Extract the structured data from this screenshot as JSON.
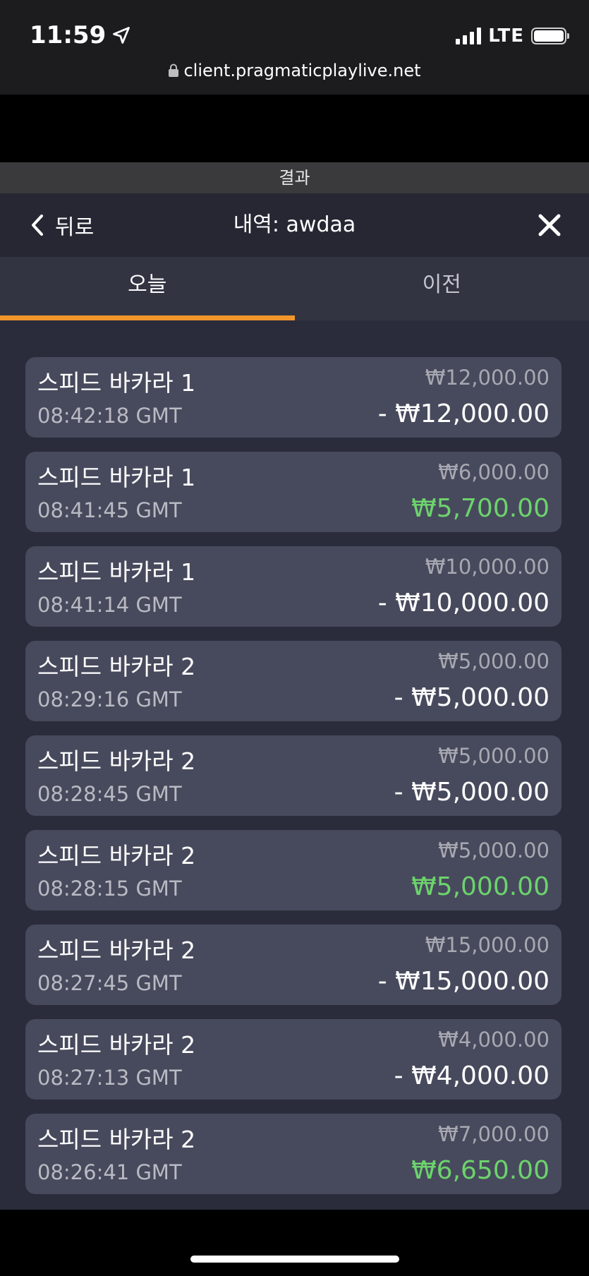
{
  "status_bar": {
    "time": "11:59",
    "network": "LTE",
    "url": "client.pragmaticplaylive.net"
  },
  "results_strip": {
    "label": "결과"
  },
  "header": {
    "back_label": "뒤로",
    "title": "내역: awdaa"
  },
  "tabs": [
    {
      "label": "오늘",
      "active": true
    },
    {
      "label": "이전",
      "active": false
    }
  ],
  "colors": {
    "accent": "#f2962b",
    "win": "#6cd36c",
    "card": "#474a5c",
    "background": "#2a2c3b"
  },
  "history": [
    {
      "game": "스피드 바카라 1",
      "time": "08:42:18 GMT",
      "bet": "₩12,000.00",
      "result": "- ₩12,000.00",
      "win": false
    },
    {
      "game": "스피드 바카라 1",
      "time": "08:41:45 GMT",
      "bet": "₩6,000.00",
      "result": "₩5,700.00",
      "win": true
    },
    {
      "game": "스피드 바카라 1",
      "time": "08:41:14 GMT",
      "bet": "₩10,000.00",
      "result": "- ₩10,000.00",
      "win": false
    },
    {
      "game": "스피드 바카라 2",
      "time": "08:29:16 GMT",
      "bet": "₩5,000.00",
      "result": "- ₩5,000.00",
      "win": false
    },
    {
      "game": "스피드 바카라 2",
      "time": "08:28:45 GMT",
      "bet": "₩5,000.00",
      "result": "- ₩5,000.00",
      "win": false
    },
    {
      "game": "스피드 바카라 2",
      "time": "08:28:15 GMT",
      "bet": "₩5,000.00",
      "result": "₩5,000.00",
      "win": true
    },
    {
      "game": "스피드 바카라 2",
      "time": "08:27:45 GMT",
      "bet": "₩15,000.00",
      "result": "- ₩15,000.00",
      "win": false
    },
    {
      "game": "스피드 바카라 2",
      "time": "08:27:13 GMT",
      "bet": "₩4,000.00",
      "result": "- ₩4,000.00",
      "win": false
    },
    {
      "game": "스피드 바카라 2",
      "time": "08:26:41 GMT",
      "bet": "₩7,000.00",
      "result": "₩6,650.00",
      "win": true
    }
  ]
}
